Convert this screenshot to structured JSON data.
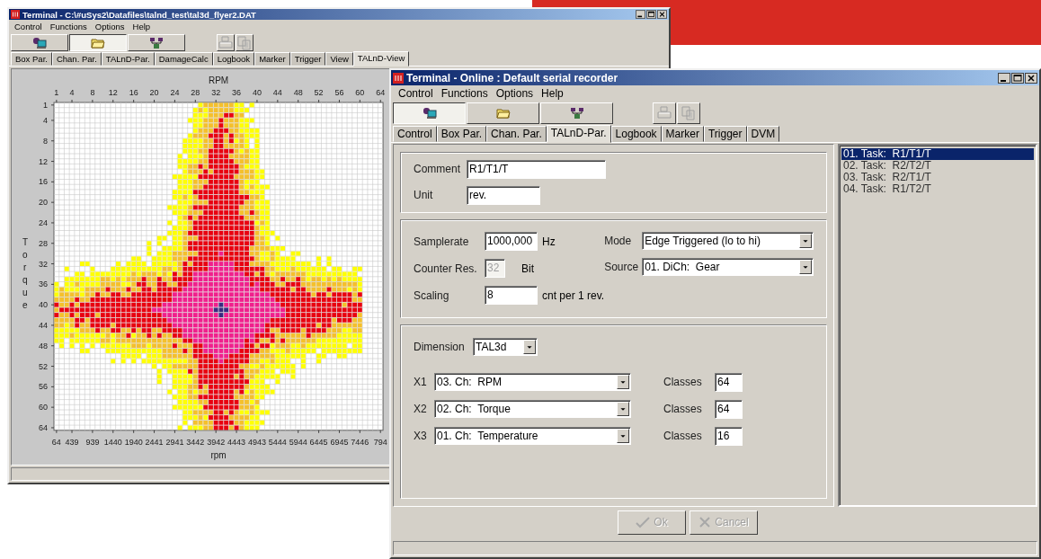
{
  "data_window": {
    "title": "Terminal - C:\\#uSys2\\Datafiles\\talnd_test\\tal3d_flyer2.DAT",
    "menu": [
      "Control",
      "Functions",
      "Options",
      "Help"
    ],
    "toolbar": [
      {
        "kind": "computer",
        "pressed": false
      },
      {
        "kind": "folder",
        "pressed": true
      },
      {
        "kind": "network",
        "pressed": false
      },
      {
        "kind": "print",
        "pressed": false
      },
      {
        "kind": "copy",
        "pressed": false
      }
    ],
    "tabs": [
      {
        "label": "Box Par.",
        "selected": false
      },
      {
        "label": "Chan. Par.",
        "selected": false
      },
      {
        "label": "TALnD-Par.",
        "selected": false
      },
      {
        "label": "DamageCalc",
        "selected": false
      },
      {
        "label": "Logbook",
        "selected": false
      },
      {
        "label": "Marker",
        "selected": false
      },
      {
        "label": "Trigger",
        "selected": false
      },
      {
        "label": "View",
        "selected": false
      },
      {
        "label": "TALnD-View",
        "selected": true
      }
    ],
    "chart": {
      "top_axis_label": "RPM",
      "top_ticks": [
        "1",
        "4",
        "8",
        "12",
        "16",
        "20",
        "24",
        "28",
        "32",
        "36",
        "40",
        "44",
        "48",
        "52",
        "56",
        "60",
        "64"
      ],
      "left_axis_label": "Torque",
      "left_ticks": [
        "1",
        "4",
        "8",
        "12",
        "16",
        "20",
        "24",
        "28",
        "32",
        "36",
        "40",
        "44",
        "48",
        "52",
        "56",
        "60",
        "64"
      ],
      "bottom_ticks": [
        "64",
        "439",
        "939",
        "1440",
        "1940",
        "2441",
        "2941",
        "3442",
        "3942",
        "4443",
        "4943",
        "5444",
        "5944",
        "6445",
        "6945",
        "7446",
        "794"
      ],
      "bottom_axis_label": "rpm"
    }
  },
  "settings_window": {
    "title": "Terminal - Online : Default serial recorder",
    "menu": [
      "Control",
      "Functions",
      "Options",
      "Help"
    ],
    "toolbar": [
      {
        "kind": "computer",
        "pressed": true
      },
      {
        "kind": "folder",
        "pressed": false
      },
      {
        "kind": "network",
        "pressed": false
      },
      {
        "kind": "print",
        "pressed": false
      },
      {
        "kind": "copy",
        "pressed": false
      }
    ],
    "tabs": [
      {
        "label": "Control",
        "selected": false
      },
      {
        "label": "Box Par.",
        "selected": false
      },
      {
        "label": "Chan. Par.",
        "selected": false
      },
      {
        "label": "TALnD-Par.",
        "selected": true
      },
      {
        "label": "Logbook",
        "selected": false
      },
      {
        "label": "Marker",
        "selected": false
      },
      {
        "label": "Trigger",
        "selected": false
      },
      {
        "label": "DVM",
        "selected": false
      }
    ],
    "comment": {
      "label": "Comment",
      "value": "R1/T1/T"
    },
    "unit": {
      "label": "Unit",
      "value": "rev."
    },
    "samplerate": {
      "label": "Samplerate",
      "value": "1000,000",
      "unit": "Hz",
      "disabled": false
    },
    "counter_res": {
      "label": "Counter Res.",
      "value": "32",
      "unit": "Bit",
      "disabled": true
    },
    "scaling": {
      "label": "Scaling",
      "value": "8",
      "unit": "cnt per 1 rev.",
      "disabled": false
    },
    "mode": {
      "label": "Mode",
      "value": "Edge Triggered (lo to hi)"
    },
    "source": {
      "label": "Source",
      "value": "01. DiCh:  Gear"
    },
    "dimension": {
      "label": "Dimension",
      "value": "TAL3d"
    },
    "axes": [
      {
        "label": "X1",
        "channel": "03. Ch:  RPM",
        "classes_label": "Classes",
        "classes": "64"
      },
      {
        "label": "X2",
        "channel": "02. Ch:  Torque",
        "classes_label": "Classes",
        "classes": "64"
      },
      {
        "label": "X3",
        "channel": "01. Ch:  Temperature",
        "classes_label": "Classes",
        "classes": "16"
      }
    ],
    "tasks": [
      {
        "label": "01. Task:  R1/T1/T",
        "selected": true
      },
      {
        "label": "02. Task:  R2/T2/T",
        "selected": false
      },
      {
        "label": "03. Task:  R2/T1/T",
        "selected": false
      },
      {
        "label": "04. Task:  R1/T2/T",
        "selected": false
      }
    ],
    "buttons": [
      {
        "kind": "ok",
        "label": "Ok",
        "disabled": true
      },
      {
        "kind": "cancel",
        "label": "Cancel",
        "disabled": true
      }
    ]
  }
}
